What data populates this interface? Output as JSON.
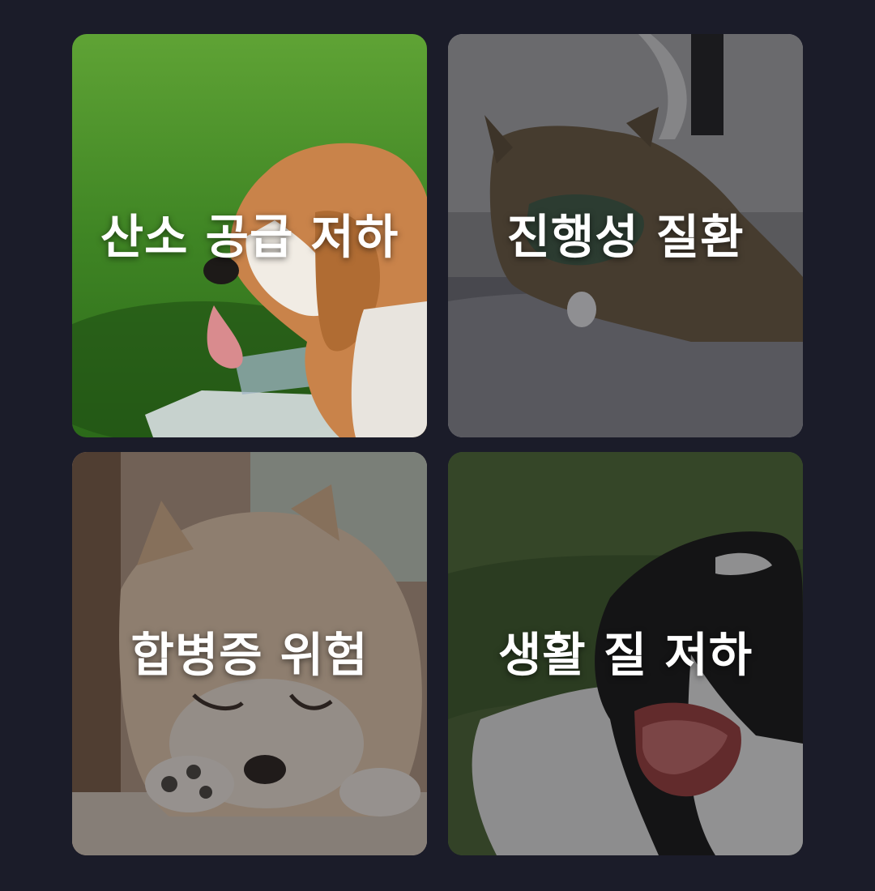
{
  "cards": [
    {
      "label": "산소 공급 저하",
      "image": "beagle-panting-on-grass",
      "colors": {
        "primary": "#4f8f2c",
        "accent": "#c9834a"
      }
    },
    {
      "label": "진행성 질환",
      "image": "tabby-cat-wearing-mask",
      "colors": {
        "primary": "#5c5c66",
        "accent": "#3f5a46"
      }
    },
    {
      "label": "합병증 위험",
      "image": "pomeranian-sleeping",
      "colors": {
        "primary": "#8a6a52",
        "accent": "#d8b08a"
      }
    },
    {
      "label": "생활 질 저하",
      "image": "black-white-dog-yawning",
      "colors": {
        "primary": "#24331e",
        "accent": "#111111"
      }
    }
  ],
  "background": "#1b1c29"
}
